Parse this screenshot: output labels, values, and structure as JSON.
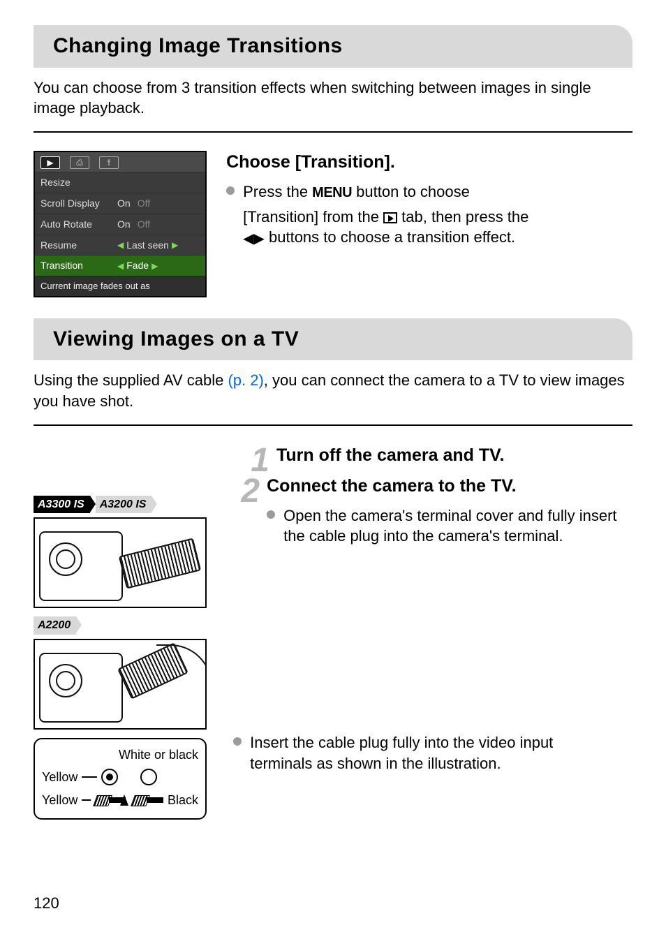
{
  "section1": {
    "heading": "Changing Image Transitions",
    "intro": "You can choose from 3 transition effects when switching between images in single image playback."
  },
  "menu": {
    "rows": [
      {
        "label": "Resize",
        "value": "",
        "extra": ""
      },
      {
        "label": "Scroll Display",
        "value": "On",
        "extra": "Off"
      },
      {
        "label": "Auto Rotate",
        "value": "On",
        "extra": "Off"
      },
      {
        "label": "Resume",
        "value": "Last seen",
        "arrows": true
      },
      {
        "label": "Transition",
        "value": "Fade",
        "arrows": true,
        "highlight": true
      }
    ],
    "desc": "Current image fades out as"
  },
  "transition_step": {
    "title": "Choose [Transition].",
    "line1a": "Press the ",
    "line1b": " button to choose",
    "line2a": "[Transition] from the ",
    "line2b": " tab, then press the",
    "line3a": " buttons to choose a transition effect.",
    "menu_word": "MENU"
  },
  "section2": {
    "heading": "Viewing Images on a TV",
    "intro_a": "Using the supplied AV cable ",
    "intro_link": "(p. 2)",
    "intro_b": ", you can connect the camera to a TV to view images you have shot."
  },
  "models": {
    "m1": "A3300 IS",
    "m2": "A3200 IS",
    "m3": "A2200"
  },
  "steps": {
    "s1": {
      "num": "1",
      "title": "Turn off the camera and TV."
    },
    "s2": {
      "num": "2",
      "title": "Connect the camera to the TV.",
      "bullet1": "Open the camera's terminal cover and fully insert the cable plug into the camera's terminal.",
      "bullet2": "Insert the cable plug fully into the video input terminals as shown in the illustration."
    }
  },
  "cable": {
    "top": "White or black",
    "yellow": "Yellow",
    "black": "Black"
  },
  "page_number": "120"
}
